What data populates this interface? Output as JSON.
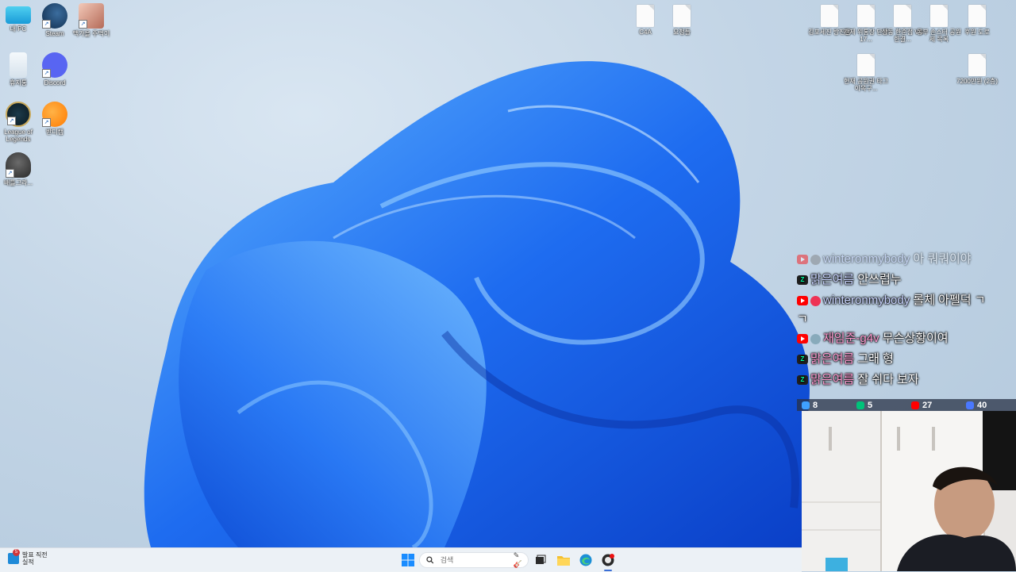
{
  "desktop_icons": [
    {
      "label": "내 PC",
      "icon": "monitor-icon"
    },
    {
      "label": "Steam",
      "icon": "steam-icon"
    },
    {
      "label": "맥가을 주먹이",
      "icon": "game-app-icon"
    },
    {
      "label": "휴지통",
      "icon": "recycle-bin-icon"
    },
    {
      "label": "Discord",
      "icon": "discord-icon"
    },
    {
      "label": "League of Legends",
      "icon": "league-icon"
    },
    {
      "label": "반디캠",
      "icon": "orange-app-icon"
    },
    {
      "label": "배틀그라...",
      "icon": "pubg-icon"
    }
  ],
  "desktop_files": [
    {
      "label": "C4A"
    },
    {
      "label": "요청들"
    },
    {
      "label": "김포세진 방진팀"
    },
    {
      "label": "관제 위통장 단가 17..."
    },
    {
      "label": "상동 한준점 VS 한결..."
    },
    {
      "label": "동부 손스터 공원제 목록"
    },
    {
      "label": "후원 도로"
    },
    {
      "label": "현재 공원권 타그이목구..."
    },
    {
      "label": "7200만원 (2층)"
    }
  ],
  "chat": {
    "messages": [
      {
        "platform": "youtube",
        "user": "winteronmybody",
        "text": "아 쿼쿼이야",
        "faded": true
      },
      {
        "platform": "chzzk",
        "user": "맑은여름",
        "text": "안쓰럽누",
        "faded": false
      },
      {
        "platform": "youtube",
        "user": "winteronmybody",
        "text": "롤체 아펠덕 ㄱ",
        "cont": "ㄱ",
        "faded": false
      },
      {
        "platform": "youtube",
        "user": "재임준-g4v",
        "text": "무슨상황이여",
        "faded": false
      },
      {
        "platform": "chzzk",
        "user": "맑은여름",
        "text": "그래 형",
        "faded": false
      },
      {
        "platform": "chzzk",
        "user": "맑은여름",
        "text": "잘 쉬다 보자",
        "faded": false
      }
    ],
    "stats": [
      {
        "icon": "link-icon",
        "value": "8",
        "color": "#3fa0ff"
      },
      {
        "icon": "chzzk-icon",
        "value": "5",
        "color": "#00c37a"
      },
      {
        "icon": "youtube-icon",
        "value": "27",
        "color": "#ff0000"
      },
      {
        "icon": "viewer-icon",
        "value": "40",
        "color": "#4a78ff"
      }
    ]
  },
  "taskbar": {
    "weather_line1": "발표 직전",
    "weather_line2": "실적",
    "weather_badge": "5",
    "search_placeholder": "검색",
    "items": [
      {
        "name": "start-button",
        "icon": "windows-icon"
      },
      {
        "name": "taskview-button",
        "icon": "taskview-icon"
      },
      {
        "name": "file-explorer-button",
        "icon": "folder-icon"
      },
      {
        "name": "edge-button",
        "icon": "edge-icon"
      },
      {
        "name": "obs-button",
        "icon": "obs-icon"
      }
    ]
  },
  "colors": {
    "bloom_dark": "#0a3fc7",
    "bloom_light": "#4aa2ff",
    "taskbar": "#eef2f7"
  }
}
